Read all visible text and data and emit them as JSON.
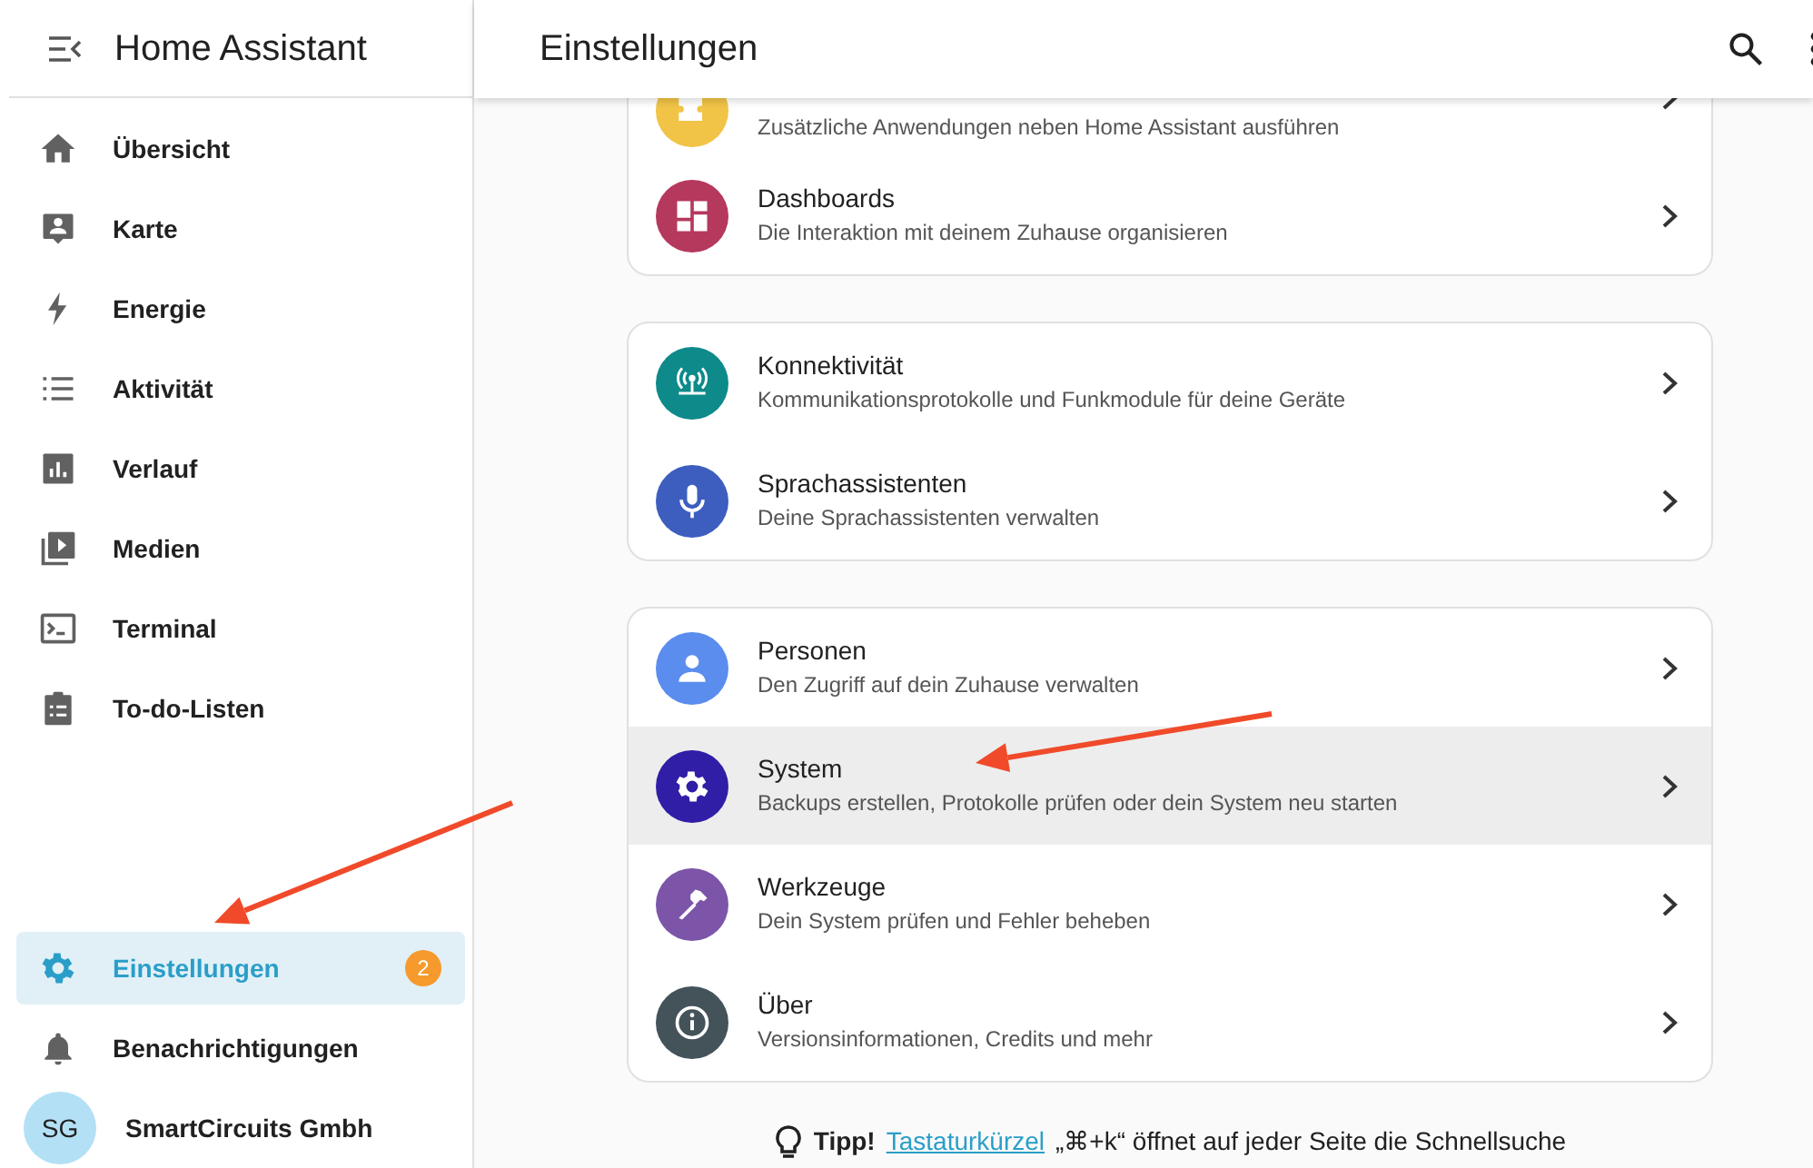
{
  "sidebar": {
    "title": "Home Assistant",
    "items": [
      {
        "label": "Übersicht",
        "selected": false
      },
      {
        "label": "Karte",
        "selected": false
      },
      {
        "label": "Energie",
        "selected": false
      },
      {
        "label": "Aktivität",
        "selected": false
      },
      {
        "label": "Verlauf",
        "selected": false
      },
      {
        "label": "Medien",
        "selected": false
      },
      {
        "label": "Terminal",
        "selected": false
      },
      {
        "label": "To-do-Listen",
        "selected": false
      }
    ],
    "bottom_items": [
      {
        "label": "Einstellungen",
        "selected": true,
        "badge": "2"
      },
      {
        "label": "Benachrichtigungen",
        "selected": false
      }
    ],
    "user": {
      "initials": "SG",
      "name": "SmartCircuits Gmbh"
    }
  },
  "header": {
    "title": "Einstellungen"
  },
  "cards": [
    {
      "rows": [
        {
          "description": "Zusätzliche Anwendungen neben Home Assistant ausführen",
          "color": "#f1c447",
          "highlighted": false,
          "kind": "partial"
        },
        {
          "title": "Dashboards",
          "description": "Die Interaktion mit deinem Zuhause organisieren",
          "color": "#b5385d",
          "highlighted": false,
          "kind": "full"
        }
      ]
    },
    {
      "rows": [
        {
          "title": "Konnektivität",
          "description": "Kommunikationsprotokolle und Funkmodule für deine Geräte",
          "color": "#0e8a8a",
          "highlighted": false,
          "kind": "full"
        },
        {
          "title": "Sprachassistenten",
          "description": "Deine Sprachassistenten verwalten",
          "color": "#3d5ebf",
          "highlighted": false,
          "kind": "full"
        }
      ]
    },
    {
      "rows": [
        {
          "title": "Personen",
          "description": "Den Zugriff auf dein Zuhause verwalten",
          "color": "#5b8def",
          "highlighted": false,
          "kind": "full"
        },
        {
          "title": "System",
          "description": "Backups erstellen, Protokolle prüfen oder dein System neu starten",
          "color": "#301ea6",
          "highlighted": true,
          "kind": "full"
        },
        {
          "title": "Werkzeuge",
          "description": "Dein System prüfen und Fehler beheben",
          "color": "#7c55a8",
          "highlighted": false,
          "kind": "full"
        },
        {
          "title": "Über",
          "description": "Versionsinformationen, Credits und mehr",
          "color": "#44525a",
          "highlighted": false,
          "kind": "full"
        }
      ]
    }
  ],
  "tip": {
    "label": "Tipp!",
    "link": "Tastaturkürzel",
    "text": "„⌘+k“ öffnet auf jeder Seite die Schnellsuche"
  },
  "annotations": [
    {
      "kind": "arrow"
    },
    {
      "kind": "arrow"
    }
  ]
}
